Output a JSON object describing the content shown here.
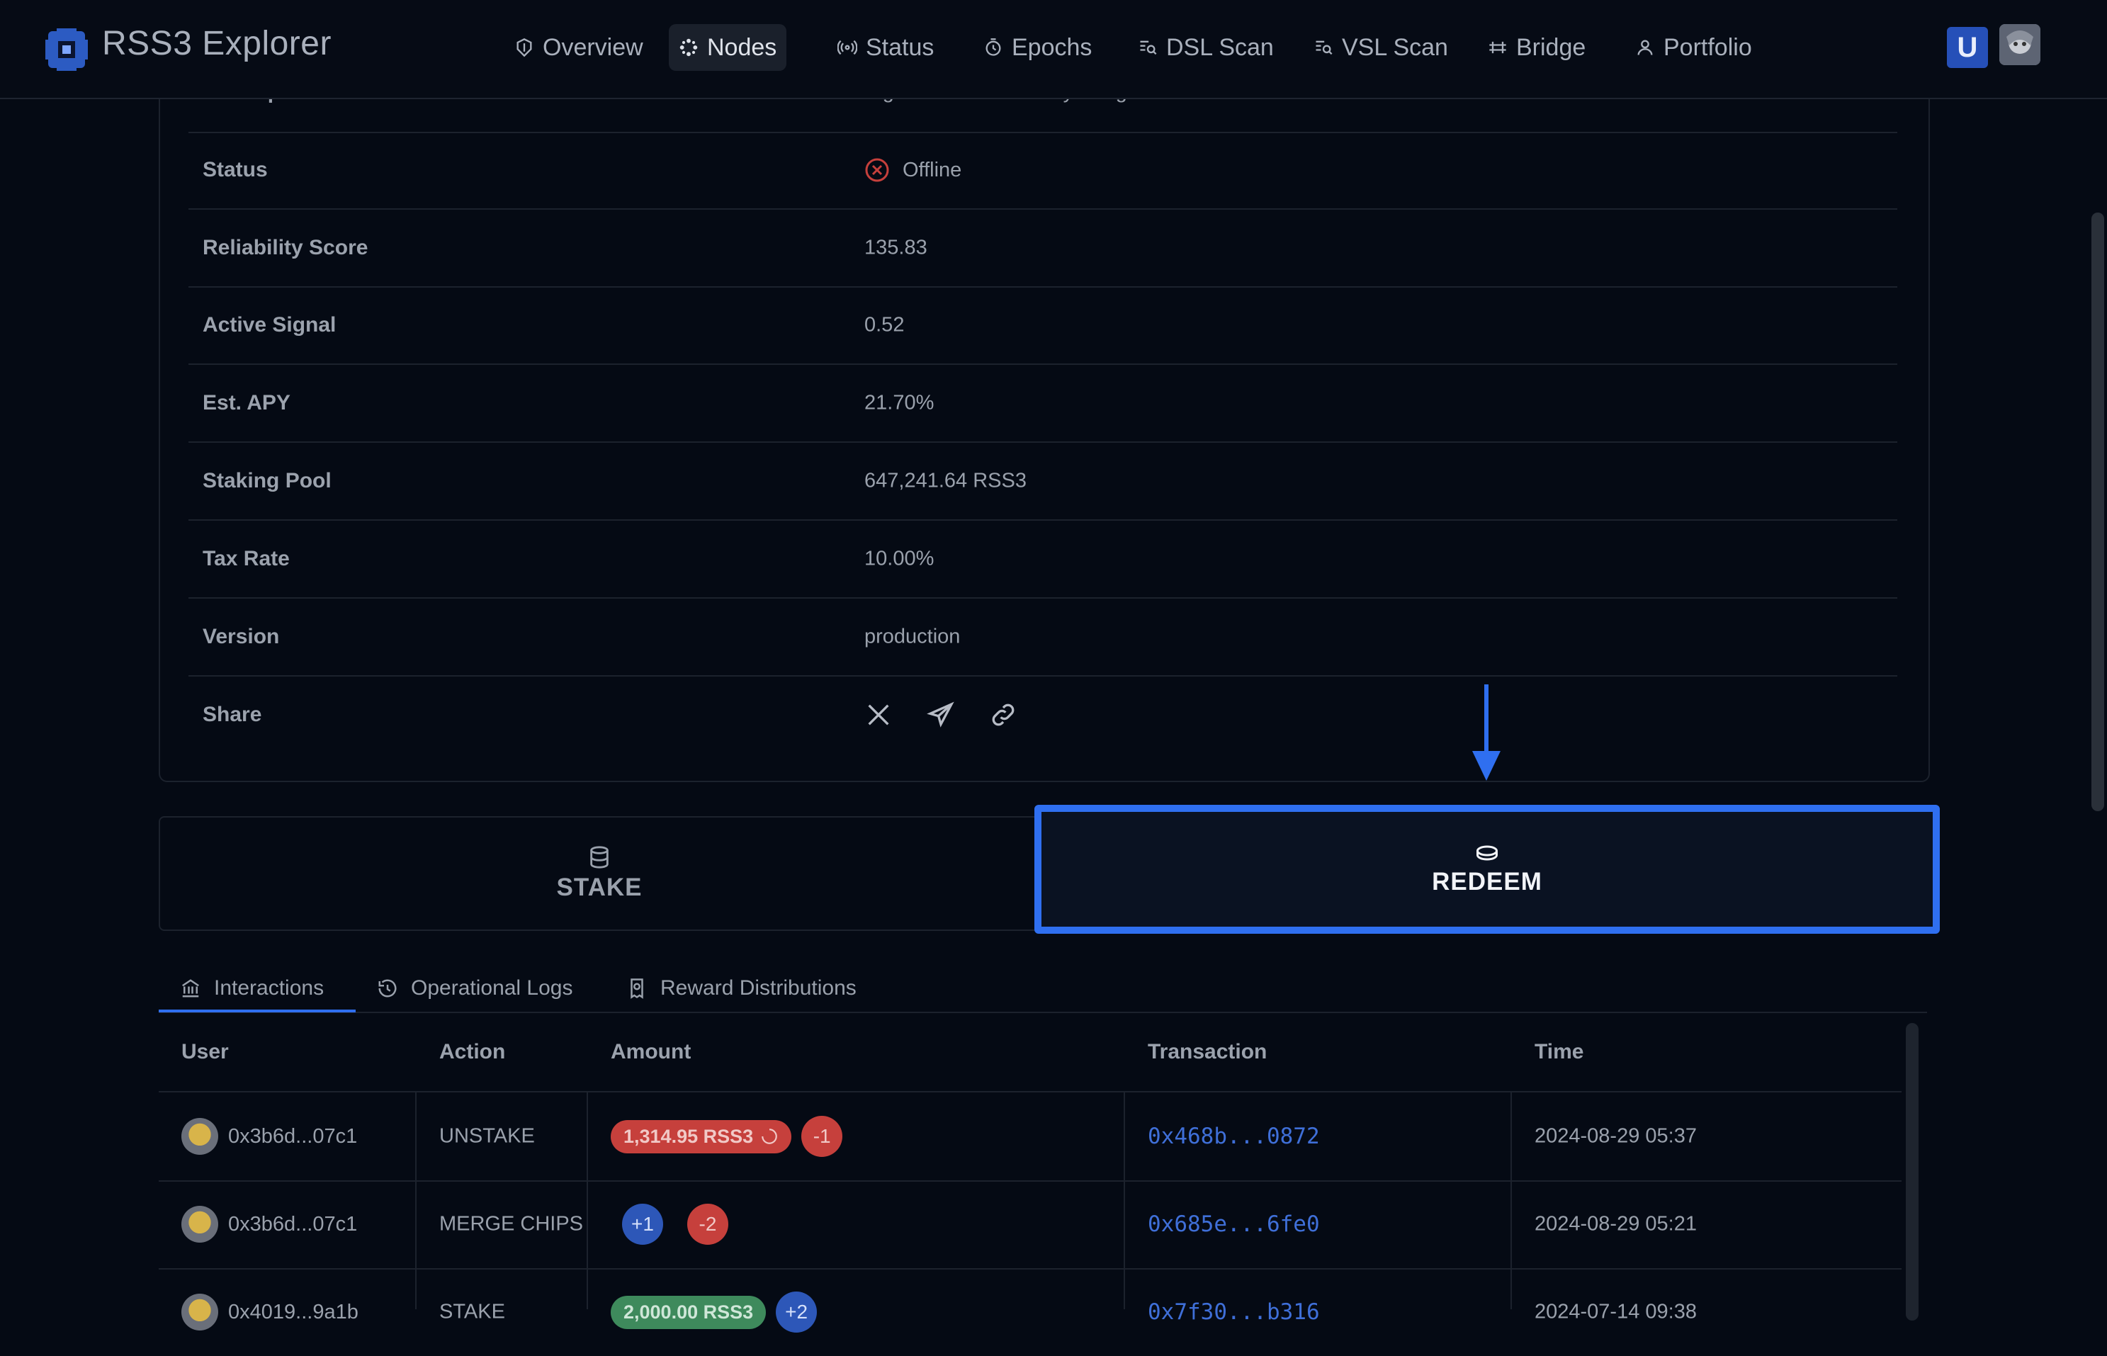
{
  "header": {
    "app_title": "RSS3 Explorer",
    "nav": [
      {
        "label": "Overview",
        "icon": "overview-icon"
      },
      {
        "label": "Nodes",
        "icon": "nodes-icon",
        "active": true
      },
      {
        "label": "Status",
        "icon": "signal-icon"
      },
      {
        "label": "Epochs",
        "icon": "epochs-icon"
      },
      {
        "label": "DSL Scan",
        "icon": "scan-icon"
      },
      {
        "label": "VSL Scan",
        "icon": "scan-icon"
      },
      {
        "label": "Bridge",
        "icon": "bridge-icon"
      },
      {
        "label": "Portfolio",
        "icon": "user-icon"
      }
    ],
    "wallet_badge": "U"
  },
  "details": {
    "description_label": "Description",
    "description_value": "A good node owned by Seag.",
    "rows": [
      {
        "label": "Status",
        "value": "Offline"
      },
      {
        "label": "Reliability Score",
        "value": "135.83"
      },
      {
        "label": "Active Signal",
        "value": "0.52"
      },
      {
        "label": "Est. APY",
        "value": "21.70%"
      },
      {
        "label": "Staking Pool",
        "value": "647,241.64 RSS3"
      },
      {
        "label": "Tax Rate",
        "value": "10.00%"
      },
      {
        "label": "Version",
        "value": "production"
      },
      {
        "label": "Share",
        "value": ""
      }
    ],
    "share_icons": [
      "x-icon",
      "telegram-icon",
      "link-icon"
    ]
  },
  "actions": {
    "stake_label": "STAKE",
    "redeem_label": "REDEEM"
  },
  "subtabs": [
    {
      "label": "Interactions",
      "active": true
    },
    {
      "label": "Operational Logs"
    },
    {
      "label": "Reward Distributions"
    }
  ],
  "table": {
    "headers": [
      "User",
      "Action",
      "Amount",
      "Transaction",
      "Time"
    ],
    "rows": [
      {
        "user": "0x3b6d...07c1",
        "action": "UNSTAKE",
        "amount": "1,314.95 RSS3",
        "chips": [
          "-1"
        ],
        "tx": "0x468b...0872",
        "time": "2024-08-29 05:37"
      },
      {
        "user": "0x3b6d...07c1",
        "action": "MERGE CHIPS",
        "amount": "",
        "chips": [
          "+1",
          "-2"
        ],
        "tx": "0x685e...6fe0",
        "time": "2024-08-29 05:21"
      },
      {
        "user": "0x4019...9a1b",
        "action": "STAKE",
        "amount": "2,000.00 RSS3",
        "chips": [
          "+2"
        ],
        "tx": "0x7f30...b316",
        "time": "2024-07-14 09:38"
      }
    ]
  },
  "colors": {
    "accent": "#2f6ff0",
    "danger": "#c6403c",
    "background": "#050a14"
  }
}
